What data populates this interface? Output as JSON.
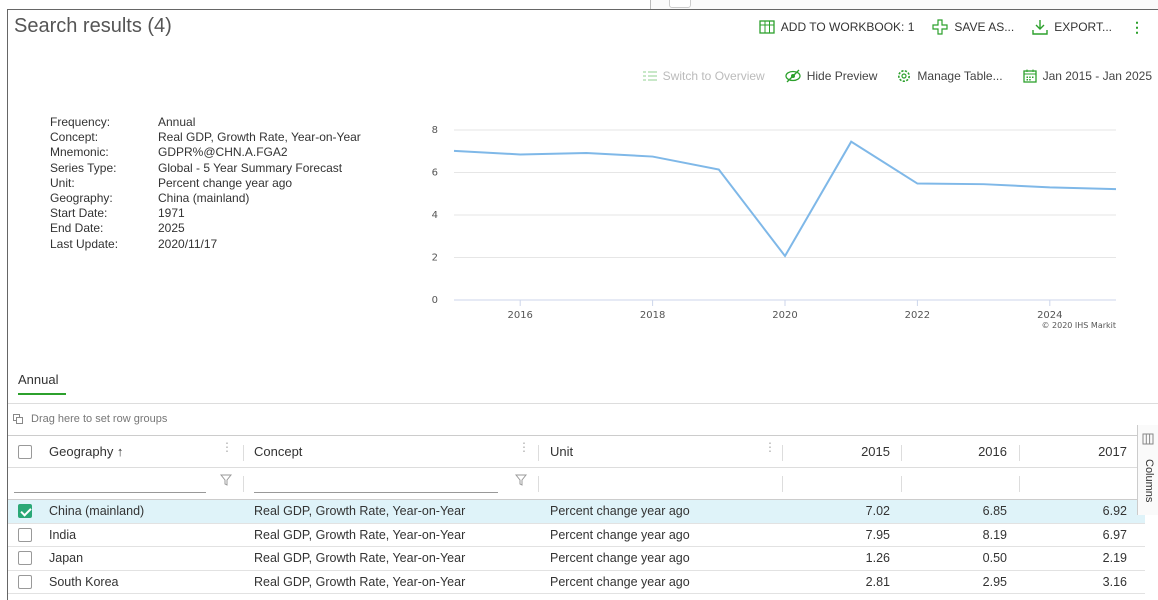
{
  "window": {
    "title": "Search results (4)"
  },
  "toolbar": {
    "add_to_workbook": "ADD TO WORKBOOK: 1",
    "save_as": "SAVE AS...",
    "export": "EXPORT...",
    "accent": "#2ca02c"
  },
  "subbar": {
    "switch_overview": "Switch to Overview",
    "hide_preview": "Hide Preview",
    "manage_table": "Manage Table...",
    "date_range": "Jan 2015 - Jan 2025"
  },
  "metadata": [
    {
      "key": "Frequency:",
      "value": "Annual"
    },
    {
      "key": "Concept:",
      "value": "Real GDP, Growth Rate, Year-on-Year"
    },
    {
      "key": "Mnemonic:",
      "value": "GDPR%@CHN.A.FGA2"
    },
    {
      "key": "Series Type:",
      "value": "Global - 5 Year Summary Forecast"
    },
    {
      "key": "Unit:",
      "value": "Percent change year ago"
    },
    {
      "key": "Geography:",
      "value": "China (mainland)"
    },
    {
      "key": "Start Date:",
      "value": "1971"
    },
    {
      "key": "End Date:",
      "value": "2025"
    },
    {
      "key": "Last Update:",
      "value": "2020/11/17"
    }
  ],
  "chart_data": {
    "type": "line",
    "x": [
      2015,
      2016,
      2017,
      2018,
      2019,
      2020,
      2021,
      2022,
      2023,
      2024,
      2025
    ],
    "series": [
      {
        "values": [
          7.02,
          6.85,
          6.92,
          6.75,
          6.14,
          2.07,
          7.45,
          5.48,
          5.45,
          5.3,
          5.22
        ],
        "color": "#7fb8e8"
      }
    ],
    "xticks": [
      "2016",
      "2018",
      "2020",
      "2022",
      "2024"
    ],
    "yticks": [
      "0",
      "2",
      "4",
      "6",
      "8"
    ],
    "xlim": [
      2015,
      2025
    ],
    "ylim": [
      0,
      8
    ],
    "grid": true,
    "credit": "© 2020 IHS Markit"
  },
  "tabs": [
    {
      "label": "Annual",
      "active": true
    }
  ],
  "groupbar": {
    "label": "Drag here to set row groups"
  },
  "grid": {
    "columns": {
      "geography": "Geography ↑",
      "concept": "Concept",
      "unit": "Unit",
      "y2015": "2015",
      "y2016": "2016",
      "y2017": "2017"
    },
    "rows": [
      {
        "checked": true,
        "geography": "China (mainland)",
        "concept": "Real GDP, Growth Rate, Year-on-Year",
        "unit": "Percent change year ago",
        "y2015": "7.02",
        "y2016": "6.85",
        "y2017": "6.92"
      },
      {
        "checked": false,
        "geography": "India",
        "concept": "Real GDP, Growth Rate, Year-on-Year",
        "unit": "Percent change year ago",
        "y2015": "7.95",
        "y2016": "8.19",
        "y2017": "6.97"
      },
      {
        "checked": false,
        "geography": "Japan",
        "concept": "Real GDP, Growth Rate, Year-on-Year",
        "unit": "Percent change year ago",
        "y2015": "1.26",
        "y2016": "0.50",
        "y2017": "2.19"
      },
      {
        "checked": false,
        "geography": "South Korea",
        "concept": "Real GDP, Growth Rate, Year-on-Year",
        "unit": "Percent change year ago",
        "y2015": "2.81",
        "y2016": "2.95",
        "y2017": "3.16"
      }
    ]
  },
  "side_tab": {
    "label": "Columns"
  }
}
